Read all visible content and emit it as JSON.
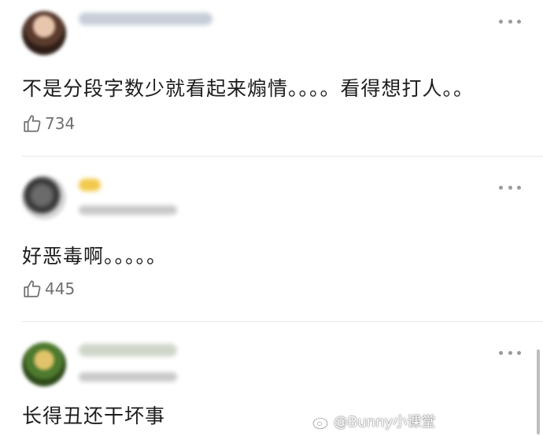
{
  "comments": [
    {
      "text": "不是分段字数少就看起来煽情。。。。看得想打人。。",
      "likes": "734"
    },
    {
      "text": "好恶毒啊。。。。。",
      "likes": "445"
    },
    {
      "text": "长得丑还干坏事"
    }
  ],
  "watermark": "@Bunny小课堂",
  "icons": {
    "like": "thumbs-up-icon",
    "more": "more-dots-icon",
    "watermark": "weibo-logo-icon"
  },
  "colors": {
    "text": "#1c1c1c",
    "secondary": "#6f6f6f",
    "divider": "#e6e6e6"
  }
}
